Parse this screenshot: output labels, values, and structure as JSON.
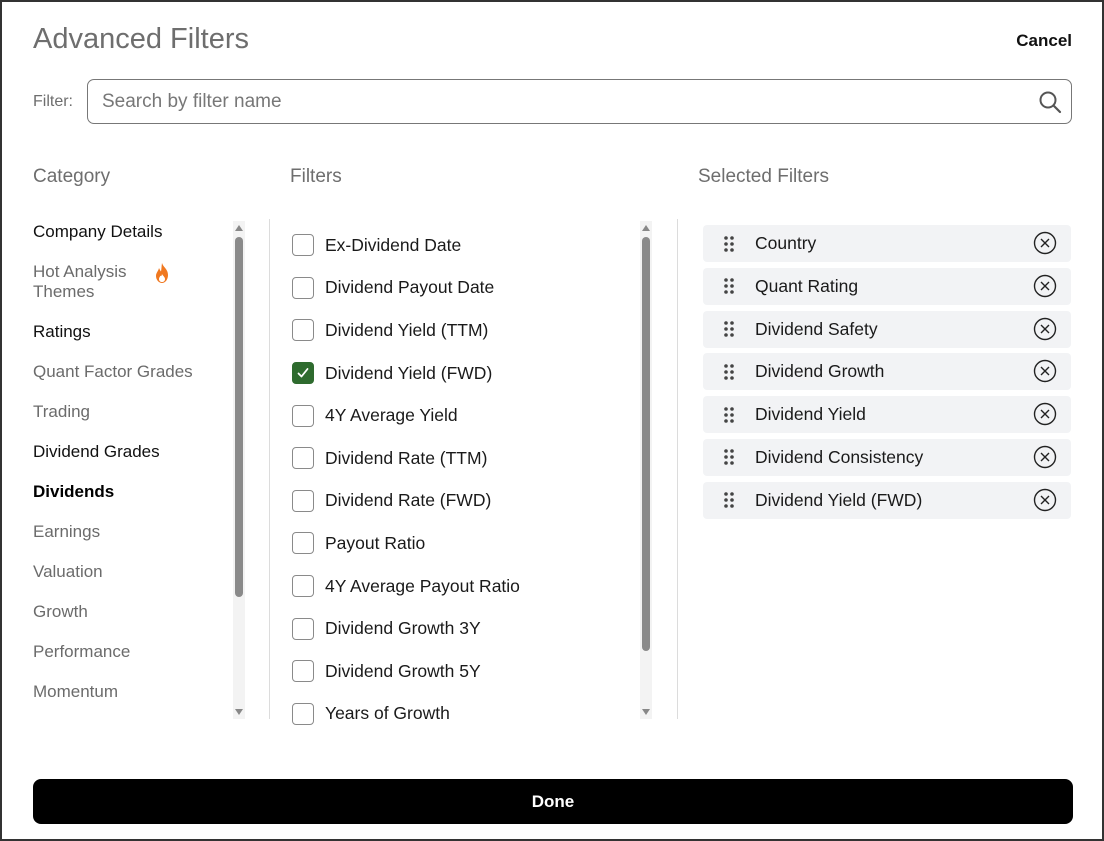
{
  "header": {
    "title": "Advanced Filters",
    "cancel_label": "Cancel"
  },
  "search": {
    "label": "Filter:",
    "placeholder": "Search by filter name",
    "value": ""
  },
  "columns": {
    "category": "Category",
    "filters": "Filters",
    "selected": "Selected Filters"
  },
  "categories": [
    {
      "label": "Company Details"
    },
    {
      "label": "Hot Analysis Themes",
      "icon": "flame-icon"
    },
    {
      "label": "Ratings"
    },
    {
      "label": "Quant Factor Grades"
    },
    {
      "label": "Trading"
    },
    {
      "label": "Dividend Grades"
    },
    {
      "label": "Dividends",
      "active": true
    },
    {
      "label": "Earnings"
    },
    {
      "label": "Valuation"
    },
    {
      "label": "Growth"
    },
    {
      "label": "Performance"
    },
    {
      "label": "Momentum"
    }
  ],
  "filters": [
    {
      "label": "Ex-Dividend Date",
      "checked": false
    },
    {
      "label": "Dividend Payout Date",
      "checked": false
    },
    {
      "label": "Dividend Yield (TTM)",
      "checked": false
    },
    {
      "label": "Dividend Yield (FWD)",
      "checked": true
    },
    {
      "label": "4Y Average Yield",
      "checked": false
    },
    {
      "label": "Dividend Rate (TTM)",
      "checked": false
    },
    {
      "label": "Dividend Rate (FWD)",
      "checked": false
    },
    {
      "label": "Payout Ratio",
      "checked": false
    },
    {
      "label": "4Y Average Payout Ratio",
      "checked": false
    },
    {
      "label": "Dividend Growth 3Y",
      "checked": false
    },
    {
      "label": "Dividend Growth 5Y",
      "checked": false
    },
    {
      "label": "Years of Growth",
      "checked": false
    }
  ],
  "selected_filters": [
    {
      "label": "Country"
    },
    {
      "label": "Quant Rating"
    },
    {
      "label": "Dividend Safety"
    },
    {
      "label": "Dividend Growth"
    },
    {
      "label": "Dividend Yield"
    },
    {
      "label": "Dividend Consistency"
    },
    {
      "label": "Dividend Yield (FWD)"
    }
  ],
  "footer": {
    "done_label": "Done"
  },
  "colors": {
    "check_green": "#2e6b2e",
    "flame_orange": "#f07820",
    "button_black": "#000000"
  }
}
